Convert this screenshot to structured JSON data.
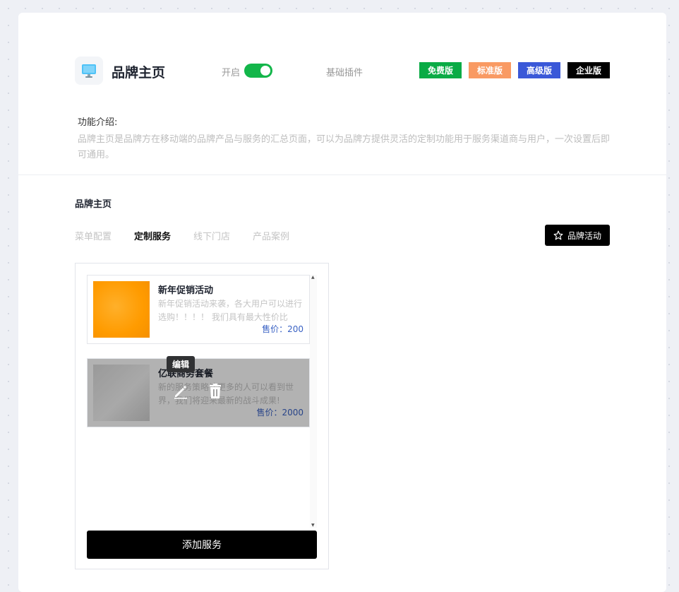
{
  "header": {
    "title": "品牌主页",
    "icon": "monitor-icon",
    "toggle_label": "开启",
    "toggle_on": true,
    "plugin_type": "基础插件",
    "badges": [
      {
        "label": "免费版",
        "color": "#0aab45"
      },
      {
        "label": "标准版",
        "color": "#f99a63"
      },
      {
        "label": "高级版",
        "color": "#3a58d8"
      },
      {
        "label": "企业版",
        "color": "#000000"
      }
    ]
  },
  "intro": {
    "title": "功能介绍:",
    "text": "品牌主页是品牌方在移动端的品牌产品与服务的汇总页面，可以为品牌方提供灵活的定制功能用于服务渠道商与用户，一次设置后即可通用。"
  },
  "section": {
    "title": "品牌主页",
    "tabs": [
      {
        "label": "菜单配置",
        "active": false
      },
      {
        "label": "定制服务",
        "active": true
      },
      {
        "label": "线下门店",
        "active": false
      },
      {
        "label": "产品案例",
        "active": false
      }
    ],
    "promo_button": "品牌活动",
    "promo_icon": "star-icon"
  },
  "services": {
    "items": [
      {
        "name": "新年促销活动",
        "desc": "新年促销活动来袭，各大用户可以进行选购！！！！ 我们具有最大性价比的...",
        "price_prefix": "售价：",
        "price": "200"
      },
      {
        "name": "亿联商务套餐",
        "desc": "新的服务策略让更多的人可以看到世界，我们将迎来最新的战斗成果!",
        "price_prefix": "售价：",
        "price": "2000"
      }
    ],
    "hover_tooltip": "编辑",
    "add_button": "添加服务"
  }
}
